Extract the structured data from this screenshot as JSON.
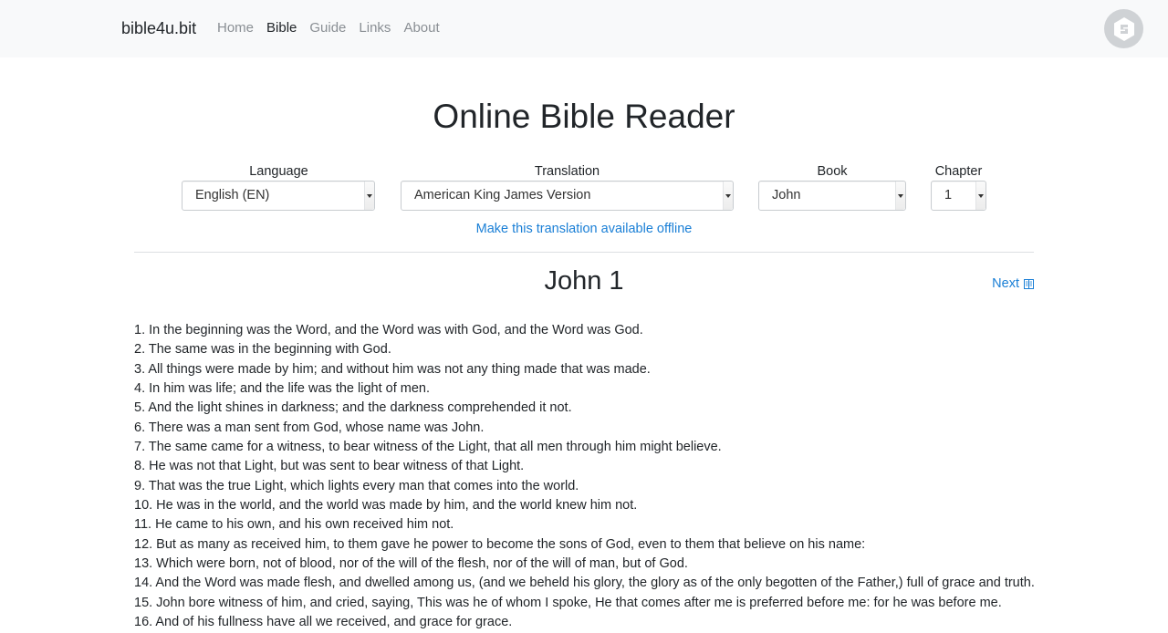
{
  "navbar": {
    "brand": "bible4u.bit",
    "links": [
      {
        "label": "Home",
        "active": false
      },
      {
        "label": "Bible",
        "active": true
      },
      {
        "label": "Guide",
        "active": false
      },
      {
        "label": "Links",
        "active": false
      },
      {
        "label": "About",
        "active": false
      }
    ],
    "logo_icon": "blockstack-logo-icon"
  },
  "main": {
    "title": "Online Bible Reader",
    "selectors": {
      "language": {
        "label": "Language",
        "value": "English (EN)"
      },
      "translation": {
        "label": "Translation",
        "value": "American King James Version"
      },
      "book": {
        "label": "Book",
        "value": "John"
      },
      "chapter": {
        "label": "Chapter",
        "value": "1"
      }
    },
    "offline_link": "Make this translation available offline",
    "chapter_heading": "John 1",
    "next_link": "Next",
    "next_icon": "book-icon",
    "link_color": "#1a7fd6",
    "verses": [
      "1. In the beginning was the Word, and the Word was with God, and the Word was God.",
      "2. The same was in the beginning with God.",
      "3. All things were made by him; and without him was not any thing made that was made.",
      "4. In him was life; and the life was the light of men.",
      "5. And the light shines in darkness; and the darkness comprehended it not.",
      "6. There was a man sent from God, whose name was John.",
      "7. The same came for a witness, to bear witness of the Light, that all men through him might believe.",
      "8. He was not that Light, but was sent to bear witness of that Light.",
      "9. That was the true Light, which lights every man that comes into the world.",
      "10. He was in the world, and the world was made by him, and the world knew him not.",
      "11. He came to his own, and his own received him not.",
      "12. But as many as received him, to them gave he power to become the sons of God, even to them that believe on his name:",
      "13. Which were born, not of blood, nor of the will of the flesh, nor of the will of man, but of God.",
      "14. And the Word was made flesh, and dwelled among us, (and we beheld his glory, the glory as of the only begotten of the Father,) full of grace and truth.",
      "15. John bore witness of him, and cried, saying, This was he of whom I spoke, He that comes after me is preferred before me: for he was before me.",
      "16. And of his fullness have all we received, and grace for grace."
    ]
  }
}
